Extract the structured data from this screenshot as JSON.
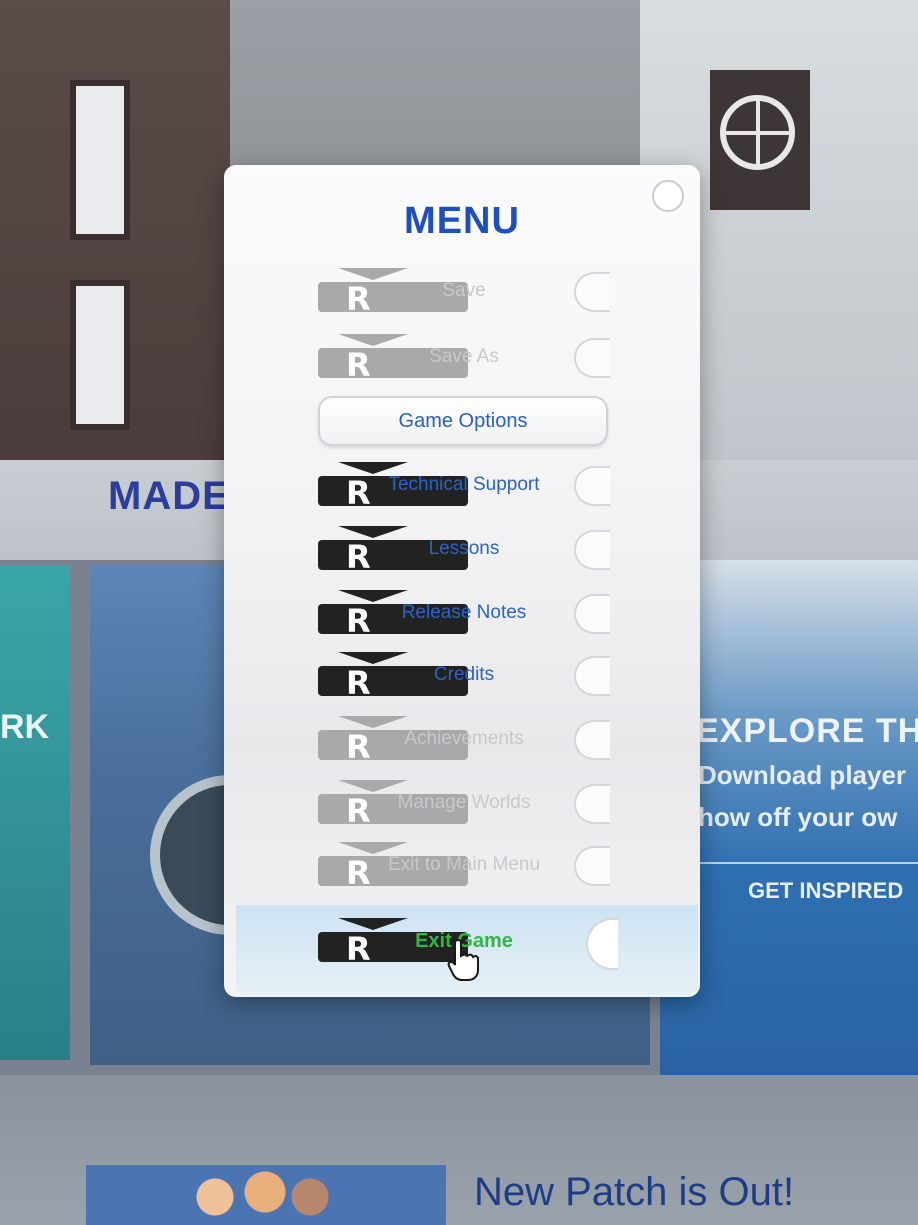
{
  "background": {
    "made_label": "MADE",
    "left_card_label": "RK",
    "explore": {
      "title": "EXPLORE TH",
      "subtitle_line1": "Download player",
      "subtitle_line2": "how off your ow",
      "button_label": "GET INSPIRED"
    },
    "patch_banner": {
      "title": "New Patch is Out!"
    }
  },
  "menu": {
    "title": "MENU",
    "close_icon": "close-circle-icon",
    "items": [
      {
        "label": "Save",
        "state": "disabled"
      },
      {
        "label": "Save As",
        "state": "disabled"
      },
      {
        "label": "Game Options",
        "state": "enabled"
      },
      {
        "label": "Technical Support",
        "state": "enabled"
      },
      {
        "label": "Lessons",
        "state": "enabled"
      },
      {
        "label": "Release Notes",
        "state": "enabled"
      },
      {
        "label": "Credits",
        "state": "enabled"
      },
      {
        "label": "Achievements",
        "state": "disabled"
      },
      {
        "label": "Manage Worlds",
        "state": "disabled"
      },
      {
        "label": "Exit to Main Menu",
        "state": "disabled"
      },
      {
        "label": "Exit Game",
        "state": "hovered"
      }
    ]
  },
  "colors": {
    "menu_title": "#1f4fbf",
    "link_blue": "#2b63c4",
    "hover_green": "#2fb744",
    "disabled_grey": "#c9c9cc"
  }
}
